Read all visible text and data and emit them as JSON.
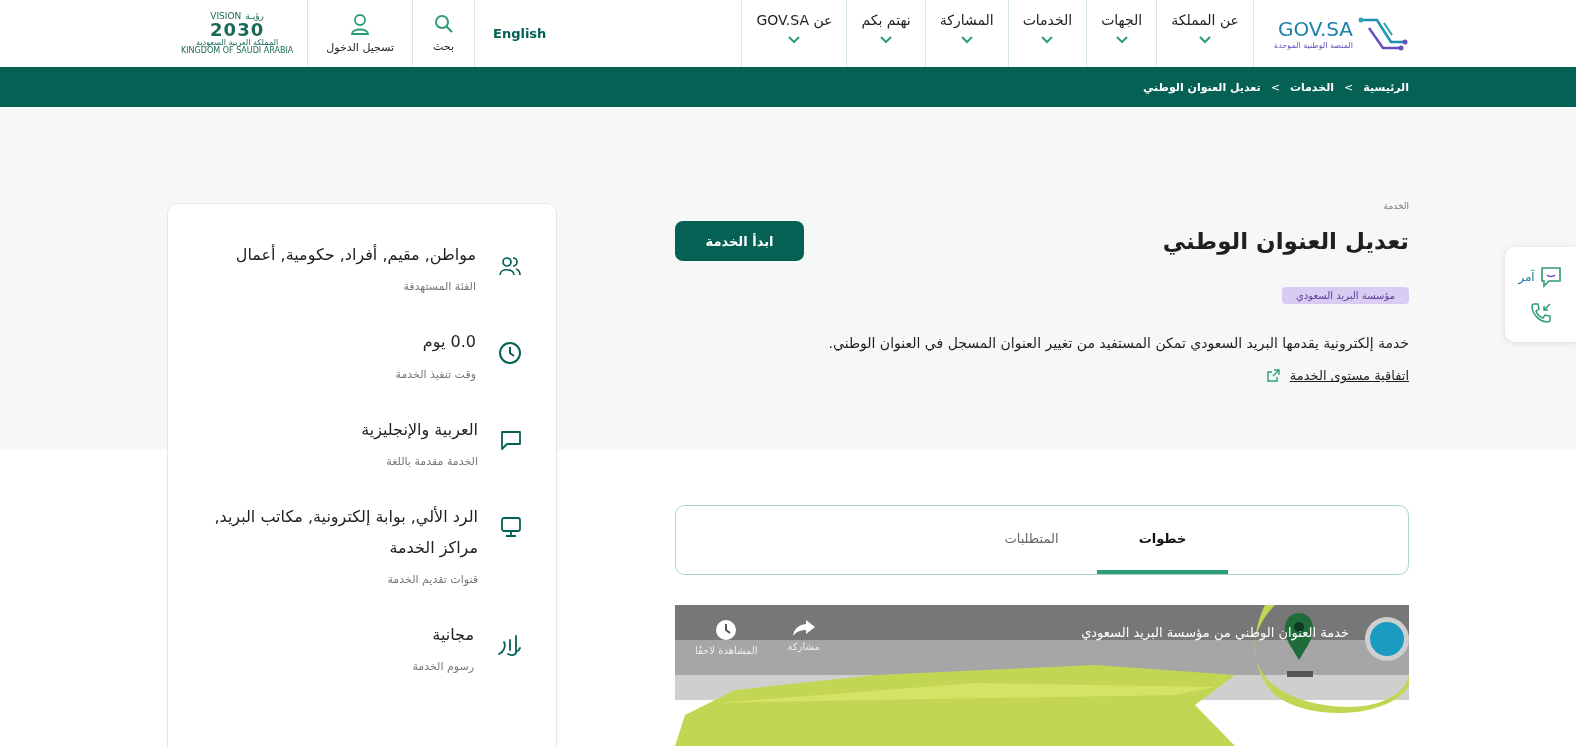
{
  "header": {
    "logo": {
      "name": "GOV.SA",
      "tagline": "المنصة الوطنية الموحدة"
    },
    "nav": [
      {
        "label": "عن المملكة"
      },
      {
        "label": "الجهات"
      },
      {
        "label": "الخدمات"
      },
      {
        "label": "المشاركة"
      },
      {
        "label": "نهتم بكم"
      },
      {
        "label": "عن GOV.SA"
      }
    ],
    "language": "English",
    "search": "بحث",
    "login": "تسجيل الدخول",
    "vision_logo": {
      "word_en": "VISION",
      "word_ar": "رؤيـة",
      "year": "2030",
      "country_ar": "المملكة العربية السعودية",
      "country_en": "KINGDOM OF SAUDI ARABIA"
    }
  },
  "breadcrumb": {
    "separator": ">",
    "items": [
      "الرئيسية",
      "الخدمات",
      "تعديل العنوان الوطني"
    ]
  },
  "service": {
    "eyebrow": "الخدمة",
    "title": "تعديل العنوان الوطني",
    "start_button": "ابدأ الخدمة",
    "agency": "مؤسسة البريد السعودي",
    "description": "خدمة إلكترونية يقدمها البريد السعودي تمكن المستفيد من تغيير العنوان المسجل في العنوان الوطني.",
    "link": "اتفاقية مستوى الخدمة"
  },
  "tabs": [
    {
      "label": "خطوات",
      "selected": true
    },
    {
      "label": "المتطلبات",
      "selected": false
    }
  ],
  "video": {
    "title": "خدمة العنوان الوطني من مؤسسة البريد السعودي",
    "watch_later": "المشاهدة لاحقًا",
    "share": "مشاركة"
  },
  "details": [
    {
      "kind": "audience",
      "value": "مواطن, مقيم, أفراد, حكومية, أعمال",
      "label": "الفئة المستهدفة"
    },
    {
      "kind": "time",
      "value": "0.0 يوم",
      "label": "وقت تنفيذ الخدمة"
    },
    {
      "kind": "language",
      "value": "العربية والإنجليزية",
      "label": "الخدمة مقدمة باللغة"
    },
    {
      "kind": "channels",
      "value": "الرد الألي, بوابة إلكترونية, مكاتب البريد, مراكز الخدمة",
      "label": "قنوات تقديم الخدمة"
    },
    {
      "kind": "fees",
      "value": "مجانية",
      "label": "رسوم الخدمة"
    }
  ],
  "floating": {
    "chat_label": "آمر"
  }
}
